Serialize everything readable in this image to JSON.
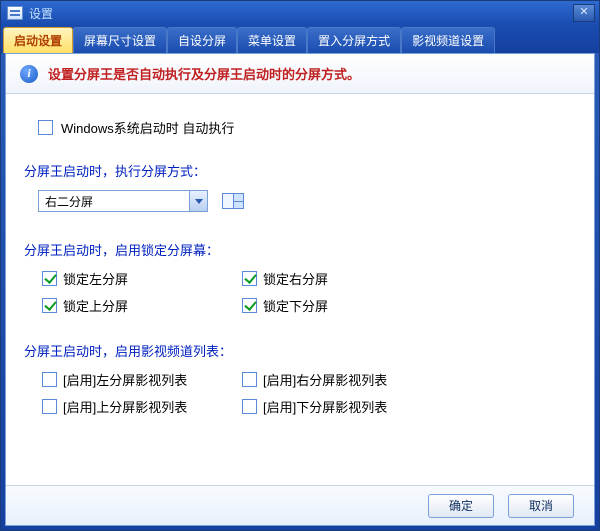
{
  "window": {
    "title": "设置"
  },
  "tabs": [
    "启动设置",
    "屏幕尺寸设置",
    "自设分屏",
    "菜单设置",
    "置入分屏方式",
    "影视频道设置"
  ],
  "active_tab_index": 0,
  "info": {
    "glyph": "i",
    "text": "设置分屏王是否自动执行及分屏王启动时的分屏方式。"
  },
  "autorun": {
    "label": "Windows系统启动时 自动执行",
    "checked": false
  },
  "sections": {
    "mode": {
      "label": "分屏王启动时，执行分屏方式：",
      "combo_value": "右二分屏"
    },
    "lock": {
      "label": "分屏王启动时，启用锁定分屏幕：",
      "items": [
        {
          "label": "锁定左分屏",
          "checked": true
        },
        {
          "label": "锁定右分屏",
          "checked": true
        },
        {
          "label": "锁定上分屏",
          "checked": true
        },
        {
          "label": "锁定下分屏",
          "checked": true
        }
      ]
    },
    "video": {
      "label": "分屏王启动时，启用影视频道列表：",
      "items": [
        {
          "label": "[启用]左分屏影视列表",
          "checked": false
        },
        {
          "label": "[启用]右分屏影视列表",
          "checked": false
        },
        {
          "label": "[启用]上分屏影视列表",
          "checked": false
        },
        {
          "label": "[启用]下分屏影视列表",
          "checked": false
        }
      ]
    }
  },
  "footer": {
    "ok": "确定",
    "cancel": "取消"
  }
}
